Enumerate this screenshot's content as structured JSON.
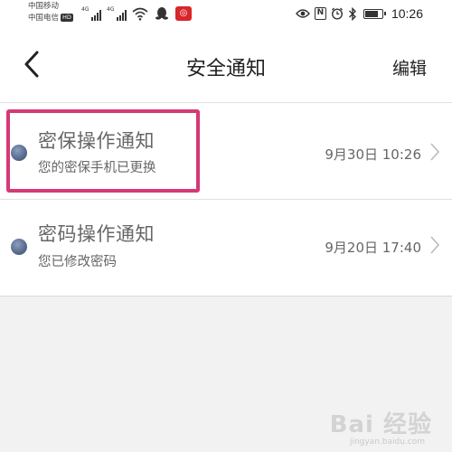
{
  "status_bar": {
    "carrier_1": "中国移动",
    "carrier_2": "中国电信",
    "hd_badge": "HD",
    "signal_tag_1": "4G",
    "signal_tag_2": "4G",
    "icons_left": [
      "signal-icon",
      "signal-icon",
      "wifi-icon",
      "qq-icon",
      "app-badge-icon"
    ],
    "icons_right": [
      "eye-icon",
      "nfc-icon",
      "alarm-icon",
      "bluetooth-icon",
      "battery-icon"
    ],
    "nfc_label": "N",
    "battery_level": 0.85,
    "time": "10:26"
  },
  "nav": {
    "back_icon": "chevron-left-icon",
    "title": "安全通知",
    "edit_label": "编辑"
  },
  "notifications": [
    {
      "title": "密保操作通知",
      "subtitle": "您的密保手机已更换",
      "time": "9月30日 10:26",
      "highlighted": true
    },
    {
      "title": "密码操作通知",
      "subtitle": "您已修改密码",
      "time": "9月20日 17:40",
      "highlighted": false
    }
  ],
  "colors": {
    "highlight": "#d63877",
    "unread_dot": "#5b6d90",
    "text_secondary": "#666666",
    "background": "#f2f2f2"
  },
  "watermark": {
    "brand": "Bai 经验",
    "sub": "jingyan.baidu.com"
  }
}
